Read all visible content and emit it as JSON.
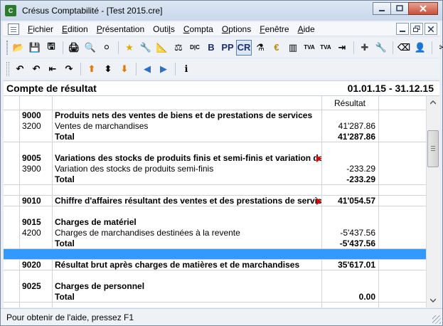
{
  "window": {
    "title": "Crésus Comptabilité - [Test 2015.cre]",
    "app_icon_text": "C"
  },
  "menu": {
    "items": [
      {
        "label": "Fichier"
      },
      {
        "label": "Edition"
      },
      {
        "label": "Présentation"
      },
      {
        "label": "Outils"
      },
      {
        "label": "Compta"
      },
      {
        "label": "Options"
      },
      {
        "label": "Fenêtre"
      },
      {
        "label": "Aide"
      }
    ]
  },
  "toolbar1": {
    "buttons": [
      {
        "name": "open-folder-icon",
        "glyph": "📂"
      },
      {
        "name": "save-icon",
        "glyph": "💾"
      },
      {
        "name": "save-as-icon",
        "glyph": "🖫"
      },
      {
        "name": "print-icon",
        "glyph": "🖨"
      },
      {
        "name": "print-preview-icon",
        "glyph": "🔍"
      },
      {
        "name": "globe-icon",
        "glyph": "⚪"
      },
      {
        "name": "star-icon",
        "glyph": "★"
      },
      {
        "name": "accounts-icon",
        "glyph": "🔧"
      },
      {
        "name": "ruler-icon",
        "glyph": "📐"
      },
      {
        "name": "balance-icon",
        "glyph": "⚖"
      },
      {
        "name": "dc-icon",
        "glyph": "D|C"
      },
      {
        "name": "b-button",
        "glyph": "B"
      },
      {
        "name": "pp-button",
        "glyph": "PP"
      },
      {
        "name": "cr-button",
        "glyph": "CR"
      },
      {
        "name": "budget-icon",
        "glyph": "⚗"
      },
      {
        "name": "currency-icon",
        "glyph": "€"
      },
      {
        "name": "chart-icon",
        "glyph": "▥"
      },
      {
        "name": "tva-icon",
        "glyph": "TVA"
      },
      {
        "name": "tva-report-icon",
        "glyph": "TVA"
      },
      {
        "name": "columns-icon",
        "glyph": "⇥"
      },
      {
        "name": "plus-icon",
        "glyph": "✚"
      },
      {
        "name": "wrench-icon",
        "glyph": "🔧"
      },
      {
        "name": "eraser-icon",
        "glyph": "⌫"
      },
      {
        "name": "user-icon",
        "glyph": "👤"
      },
      {
        "name": "scissors-icon",
        "glyph": "✂"
      }
    ]
  },
  "toolbar2": {
    "buttons": [
      {
        "name": "undo-icon",
        "glyph": "↶"
      },
      {
        "name": "undo-list-icon",
        "glyph": "↶"
      },
      {
        "name": "indent-icon",
        "glyph": "⇤"
      },
      {
        "name": "redo-list-icon",
        "glyph": "↷"
      },
      {
        "name": "move-up-icon",
        "glyph": "⬆"
      },
      {
        "name": "move-middle-icon",
        "glyph": "⬍"
      },
      {
        "name": "move-down-icon",
        "glyph": "⬇"
      },
      {
        "name": "back-icon",
        "glyph": "◀"
      },
      {
        "name": "forward-icon",
        "glyph": "▶"
      },
      {
        "name": "info-icon",
        "glyph": "ℹ"
      }
    ]
  },
  "report": {
    "title": "Compte de résultat",
    "period": "01.01.15 - 31.12.15",
    "column_header": "Résultat",
    "rows": [
      {
        "num": "9000",
        "label": "Produits nets des ventes de biens et de prestations de services",
        "value": "",
        "bold": true,
        "arrow": false,
        "sel": false
      },
      {
        "num": "3200",
        "label": "Ventes de marchandises",
        "value": "41'287.86",
        "bold": false,
        "arrow": false,
        "sel": false
      },
      {
        "num": "",
        "label": "Total",
        "value": "41'287.86",
        "bold": true,
        "arrow": false,
        "sel": false
      },
      {
        "num": "",
        "label": "",
        "value": "",
        "bold": false,
        "arrow": false,
        "sel": false
      },
      {
        "num": "9005",
        "label": "Variations des stocks de produits finis et semi-finis et variation de",
        "value": "",
        "bold": true,
        "arrow": true,
        "sel": false
      },
      {
        "num": "3900",
        "label": "Variation des stocks de produits semi-finis",
        "value": "-233.29",
        "bold": false,
        "arrow": false,
        "sel": false
      },
      {
        "num": "",
        "label": "Total",
        "value": "-233.29",
        "bold": true,
        "arrow": false,
        "sel": false
      },
      {
        "num": "",
        "label": "",
        "value": "",
        "bold": false,
        "arrow": false,
        "sel": false
      },
      {
        "num": "9010",
        "label": "Chiffre d'affaires résultant des ventes et des prestations de servic",
        "value": "41'054.57",
        "bold": true,
        "arrow": true,
        "sel": false
      },
      {
        "num": "",
        "label": "",
        "value": "",
        "bold": false,
        "arrow": false,
        "sel": false
      },
      {
        "num": "9015",
        "label": "Charges de matériel",
        "value": "",
        "bold": true,
        "arrow": false,
        "sel": false
      },
      {
        "num": "4200",
        "label": "Charges de marchandises destinées à la revente",
        "value": "-5'437.56",
        "bold": false,
        "arrow": false,
        "sel": false
      },
      {
        "num": "",
        "label": "Total",
        "value": "-5'437.56",
        "bold": true,
        "arrow": false,
        "sel": false
      },
      {
        "num": "",
        "label": "",
        "value": "",
        "bold": false,
        "arrow": false,
        "sel": true
      },
      {
        "num": "9020",
        "label": "Résultat brut après charges de matières et de marchandises",
        "value": "35'617.01",
        "bold": true,
        "arrow": false,
        "sel": false
      },
      {
        "num": "",
        "label": "",
        "value": "",
        "bold": false,
        "arrow": false,
        "sel": false
      },
      {
        "num": "9025",
        "label": "Charges de personnel",
        "value": "",
        "bold": true,
        "arrow": false,
        "sel": false
      },
      {
        "num": "",
        "label": "Total",
        "value": "0.00",
        "bold": true,
        "arrow": false,
        "sel": false
      }
    ]
  },
  "status": {
    "text": "Pour obtenir de l'aide, pressez F1"
  }
}
